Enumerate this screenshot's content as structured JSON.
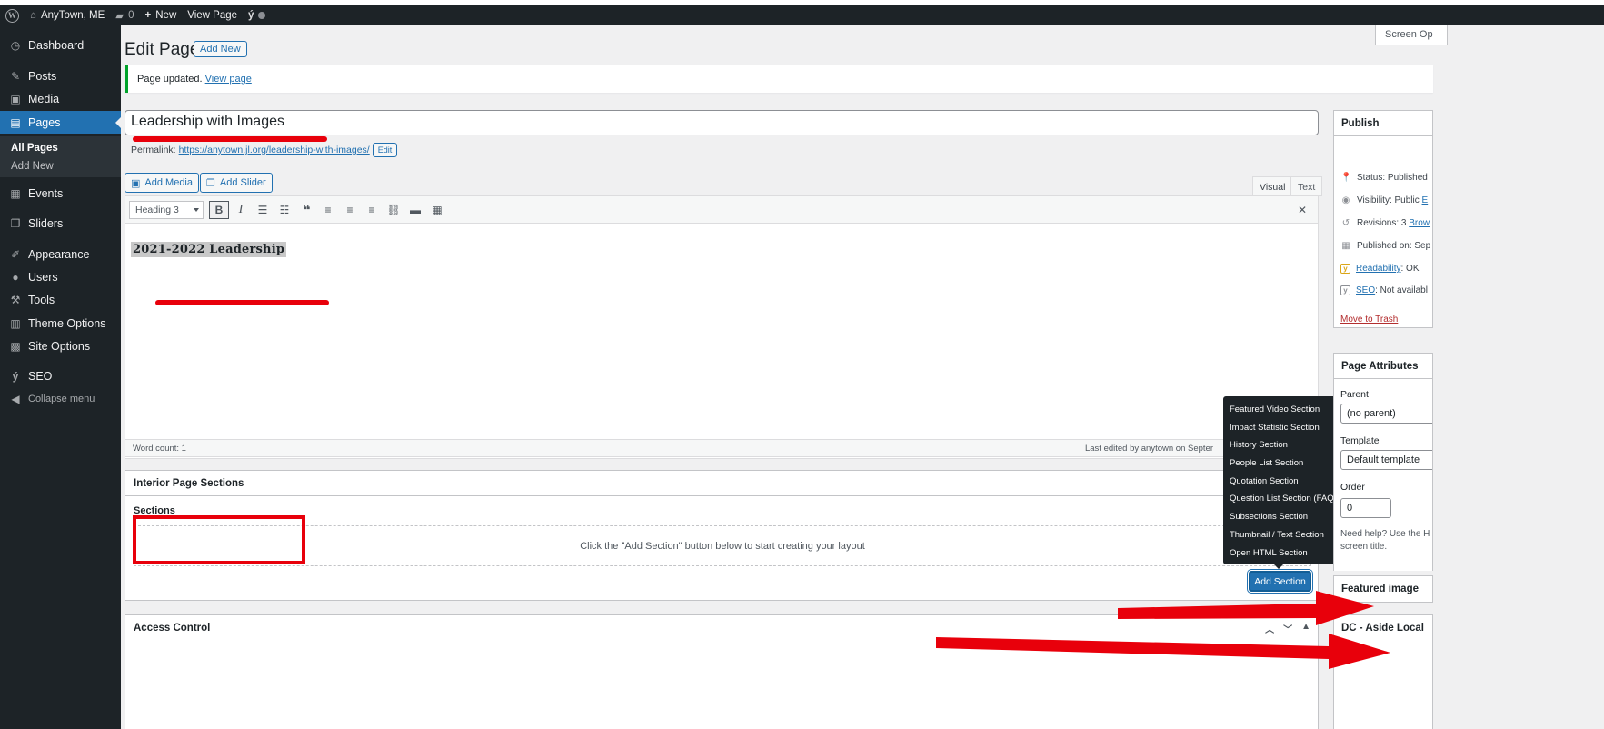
{
  "admin_bar": {
    "site_name": "AnyTown, ME",
    "comments_count": "0",
    "new_label": "New",
    "view_page_label": "View Page"
  },
  "sidebar": {
    "items": [
      {
        "label": "Dashboard",
        "icon": "dashboard-icon"
      },
      {
        "label": "Posts",
        "icon": "pin-icon"
      },
      {
        "label": "Media",
        "icon": "media-icon"
      },
      {
        "label": "Pages",
        "icon": "pages-icon"
      },
      {
        "label": "Events",
        "icon": "calendar-icon"
      },
      {
        "label": "Sliders",
        "icon": "slides-icon"
      },
      {
        "label": "Appearance",
        "icon": "brush-icon"
      },
      {
        "label": "Users",
        "icon": "user-icon"
      },
      {
        "label": "Tools",
        "icon": "wrench-icon"
      },
      {
        "label": "Theme Options",
        "icon": "table-icon"
      },
      {
        "label": "Site Options",
        "icon": "grid-icon"
      },
      {
        "label": "SEO",
        "icon": "yoast-icon"
      },
      {
        "label": "Collapse menu",
        "icon": "collapse-icon"
      }
    ],
    "submenu": [
      "All Pages",
      "Add New"
    ]
  },
  "screen_options": "Screen Op",
  "page_header": {
    "title": "Edit Page",
    "add_new": "Add New"
  },
  "notice": {
    "text": "Page updated.",
    "link": "View page"
  },
  "post_title": "Leadership with Images",
  "permalink": {
    "label": "Permalink:",
    "url": "https://anytown.jl.org/leadership-with-images/",
    "edit": "Edit"
  },
  "media_buttons": {
    "add_media": "Add Media",
    "add_slider": "Add Slider"
  },
  "editor_tabs": {
    "visual": "Visual",
    "text": "Text"
  },
  "editor": {
    "format": "Heading 3",
    "content_heading": "2021-2022  Leadership",
    "word_count": "Word count: 1",
    "last_edited": "Last edited by anytown on Septer"
  },
  "interior_sections": {
    "title": "Interior Page Sections",
    "sections_label": "Sections",
    "placeholder": "Click the \"Add Section\" button below to start creating your layout",
    "add_section": "Add Section",
    "menu": [
      "Featured Video Section",
      "Impact Statistic Section",
      "History Section",
      "People List Section",
      "Quotation Section",
      "Question List Section (FAQs)",
      "Subsections Section",
      "Thumbnail / Text Section",
      "Open HTML Section"
    ]
  },
  "access_control": {
    "title": "Access Control"
  },
  "publish": {
    "title": "Publish",
    "status_label": "Status:",
    "status_value": "Published",
    "visibility_label": "Visibility:",
    "visibility_value": "Public",
    "visibility_link": "E",
    "revisions_label": "Revisions:",
    "revisions_value": "3",
    "revisions_link": "Brow",
    "published_on": "Published on: Sep",
    "readability_link": "Readability",
    "readability_value": ": OK",
    "seo_link": "SEO",
    "seo_value": ": Not availabl",
    "trash": "Move to Trash"
  },
  "page_attributes": {
    "title": "Page Attributes",
    "parent_label": "Parent",
    "parent_value": "(no parent)",
    "template_label": "Template",
    "template_value": "Default template",
    "order_label": "Order",
    "order_value": "0",
    "help_line1": "Need help? Use the H",
    "help_line2": "screen title."
  },
  "featured_image": {
    "title": "Featured image"
  },
  "dc_aside": {
    "title": "DC - Aside Local"
  },
  "colors": {
    "admin_dark": "#1d2327",
    "accent_blue": "#2271b1",
    "annotation_red": "#e8000b",
    "success_green": "#00a32a"
  }
}
